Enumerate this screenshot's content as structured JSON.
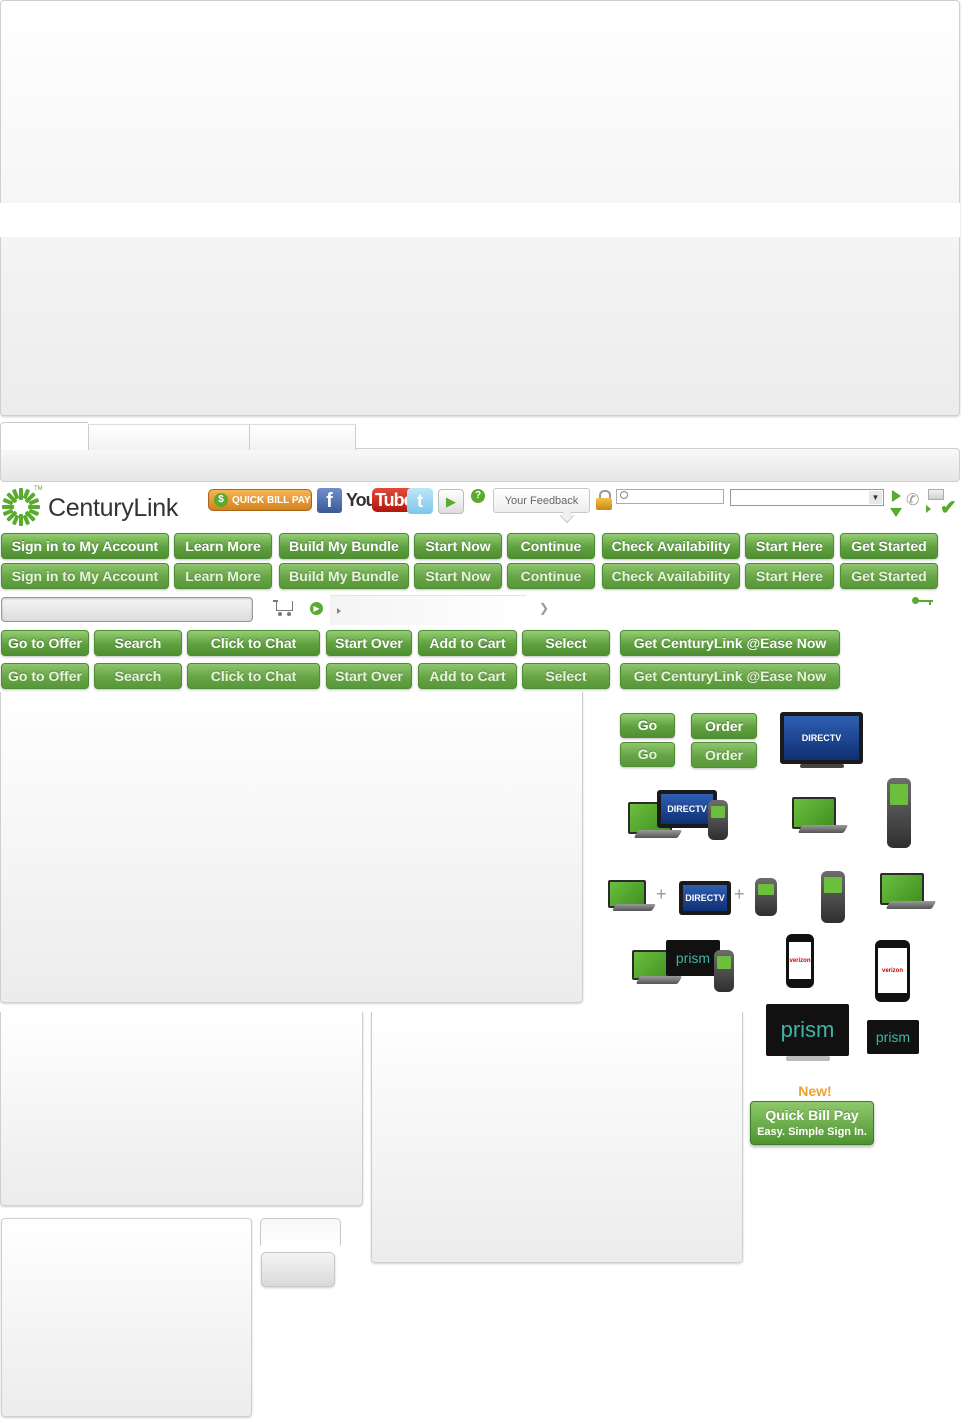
{
  "header": {
    "brand_name": "CenturyLink",
    "brand_tm": "TM",
    "quick_bill_pay_badge": "QUICK BILL PAY",
    "youtube_you": "You",
    "youtube_tube": "Tube",
    "feedback_label": "Your Feedback"
  },
  "buttons_row1": [
    "Sign in to My Account",
    "Learn More",
    "Build My Bundle",
    "Start Now",
    "Continue",
    "Check Availability",
    "Start Here",
    "Get Started"
  ],
  "buttons_row2": [
    "Sign in to My Account",
    "Learn More",
    "Build My Bundle",
    "Start Now",
    "Continue",
    "Check Availability",
    "Start Here",
    "Get Started"
  ],
  "buttons_row3": [
    "Go to Offer",
    "Search",
    "Click to Chat",
    "Start Over",
    "Add to Cart",
    "Select",
    "Get CenturyLink @Ease Now"
  ],
  "buttons_row4": [
    "Go to Offer",
    "Search",
    "Click to Chat",
    "Start Over",
    "Add to Cart",
    "Select",
    "Get CenturyLink @Ease Now"
  ],
  "small_buttons": {
    "go_1": "Go",
    "go_2": "Go",
    "order_1": "Order",
    "order_2": "Order"
  },
  "product_images": {
    "directv_label": "DIRECTV",
    "prism_label": "prism",
    "verizon_label": "verizon",
    "plus_sign": "+"
  },
  "promo": {
    "new_label": "New!",
    "title": "Quick Bill Pay",
    "subtitle": "Easy. Simple Sign In."
  },
  "colors": {
    "brand_green": "#5fa040",
    "accent_orange": "#f0a030",
    "text_dark": "#333333"
  }
}
